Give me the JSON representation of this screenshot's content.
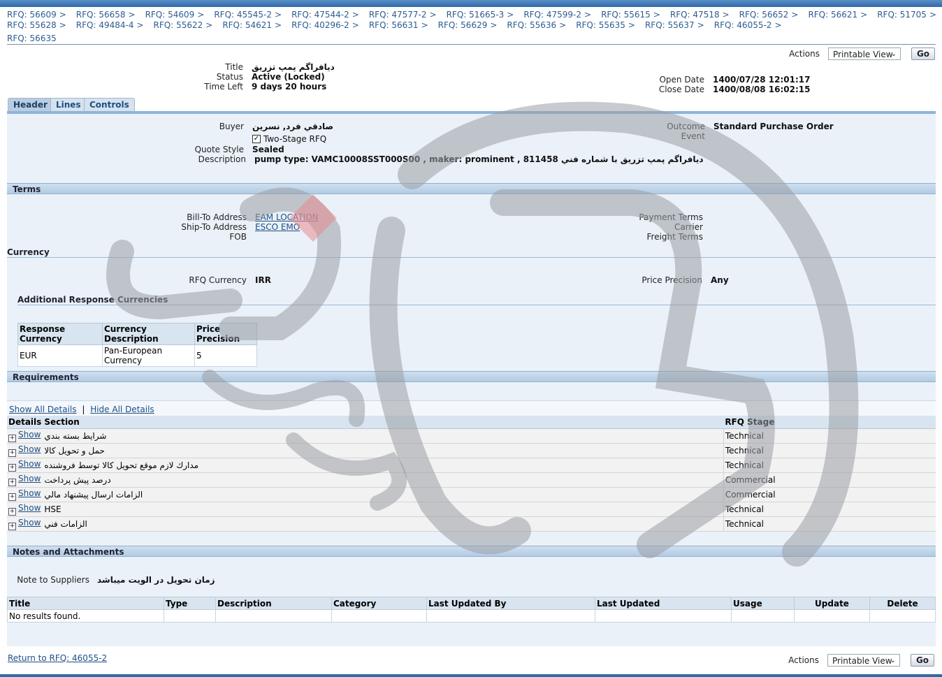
{
  "breadcrumbs": {
    "row1": [
      "RFQ: 56609",
      "RFQ: 56658",
      "RFQ: 54609",
      "RFQ: 45545-2",
      "RFQ: 47544-2",
      "RFQ: 47577-2",
      "RFQ: 51665-3",
      "RFQ: 47599-2",
      "RFQ: 55615",
      "RFQ: 47518",
      "RFQ: 56652",
      "RFQ: 56621",
      "RFQ: 51705"
    ],
    "row2": [
      "RFQ: 55628",
      "RFQ: 49484-4",
      "RFQ: 55622",
      "RFQ: 54621",
      "RFQ: 40296-2",
      "RFQ: 56631",
      "RFQ: 56629",
      "RFQ: 55636",
      "RFQ: 55635",
      "RFQ: 55637",
      "RFQ: 46055-2"
    ],
    "separator": ">"
  },
  "page_id": "RFQ: 56635",
  "actions": {
    "label": "Actions",
    "selected": "Printable View",
    "go": "Go"
  },
  "summary": {
    "title_label": "Title",
    "title": "ديافراگم پمپ تزريق",
    "status_label": "Status",
    "status": "Active (Locked)",
    "time_left_label": "Time Left",
    "time_left": "9 days 20 hours",
    "open_date_label": "Open Date",
    "open_date": "1400/07/28 12:01:17",
    "close_date_label": "Close Date",
    "close_date": "1400/08/08 16:02:15"
  },
  "tabs": [
    "Header",
    "Lines",
    "Controls"
  ],
  "header": {
    "buyer_label": "Buyer",
    "buyer": "صادقي فرد, نسرين",
    "two_stage": "Two-Stage RFQ",
    "quote_style_label": "Quote Style",
    "quote_style": "Sealed",
    "description_label": "Description",
    "description": "pump type: VAMC10008SST000S00 , maker: prominent , 811458 ديافراگم پمپ تزريق با شماره فني",
    "outcome_label": "Outcome",
    "outcome": "Standard Purchase Order",
    "event_label": "Event"
  },
  "terms": {
    "heading": "Terms",
    "bill_to_label": "Bill-To Address",
    "bill_to": "EAM LOCATION",
    "ship_to_label": "Ship-To Address",
    "ship_to": "ESCO EMO",
    "fob_label": "FOB",
    "payment_terms_label": "Payment Terms",
    "carrier_label": "Carrier",
    "freight_terms_label": "Freight Terms"
  },
  "currency": {
    "heading": "Currency",
    "rfq_currency_label": "RFQ Currency",
    "rfq_currency": "IRR",
    "price_precision_label": "Price Precision",
    "price_precision": "Any",
    "additional_heading": "Additional Response Currencies",
    "columns": [
      "Response Currency",
      "Currency Description",
      "Price Precision"
    ],
    "rows": [
      [
        "EUR",
        "Pan-European Currency",
        "5"
      ]
    ]
  },
  "requirements": {
    "heading": "Requirements",
    "show_all": "Show All Details",
    "hide_all": "Hide All Details",
    "columns": [
      "Details",
      "Section",
      "RFQ Stage"
    ],
    "show_label": "Show",
    "rows": [
      {
        "section": "شرايط بسته بندي",
        "stage": "Technical"
      },
      {
        "section": "حمل و تحويل كالا",
        "stage": "Technical"
      },
      {
        "section": "مدارك لازم موقع تحويل كالا توسط فروشنده",
        "stage": "Technical"
      },
      {
        "section": "درصد پيش پرداخت",
        "stage": "Commercial"
      },
      {
        "section": "الزامات ارسال پيشنهاد مالي",
        "stage": "Commercial"
      },
      {
        "section": "HSE",
        "stage": "Technical"
      },
      {
        "section": "الزامات فني",
        "stage": "Technical"
      }
    ]
  },
  "notes": {
    "heading": "Notes and Attachments",
    "note_label": "Note to Suppliers",
    "note": "زمان تحويل در الويت ميباشد",
    "columns": [
      "Title",
      "Type",
      "Description",
      "Category",
      "Last Updated By",
      "Last Updated",
      "Usage",
      "Update",
      "Delete"
    ],
    "empty": "No results found."
  },
  "footer": {
    "return_link": "Return to RFQ: 46055-2"
  }
}
